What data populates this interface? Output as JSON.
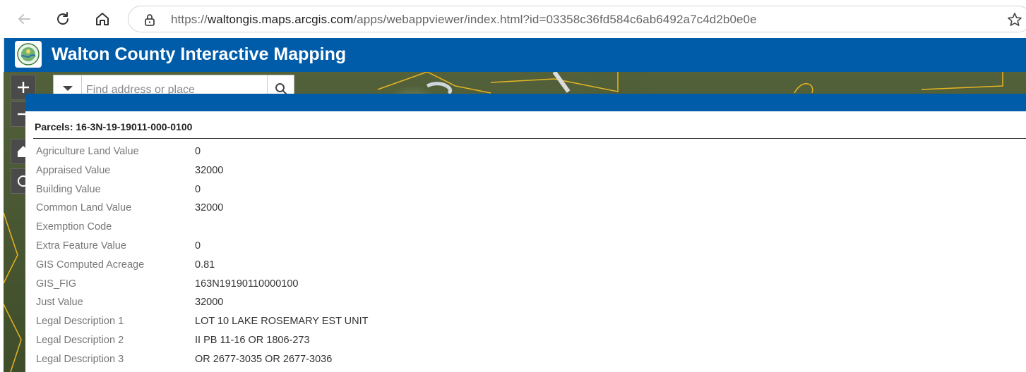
{
  "browser": {
    "url_prefix": "https://",
    "url_host": "waltongis.maps.arcgis.com",
    "url_path": "/apps/webappviewer/index.html?id=03358c36fd584c6ab6492a7c4d2b0e0e",
    "icons": [
      "back-arrow-icon",
      "reload-icon",
      "home-icon",
      "lock-icon",
      "favorite-star-icon"
    ]
  },
  "app": {
    "title": "Walton County Interactive Mapping",
    "header_color": "#005ca9",
    "logo_icon": "county-seal-logo"
  },
  "map": {
    "controls": [
      {
        "name": "zoom-in",
        "glyph": "+"
      },
      {
        "name": "zoom-out",
        "glyph": "−"
      },
      {
        "name": "default-extent",
        "glyph": "home"
      },
      {
        "name": "my-location",
        "glyph": "locate"
      }
    ],
    "search": {
      "placeholder": "Find address or place"
    }
  },
  "popup": {
    "title": "Parcels: 16-3N-19-19011-000-0100",
    "attributes": [
      {
        "name": "Agriculture Land Value",
        "value": "0"
      },
      {
        "name": "Appraised Value",
        "value": "32000"
      },
      {
        "name": "Building Value",
        "value": "0"
      },
      {
        "name": "Common Land Value",
        "value": "32000"
      },
      {
        "name": "Exemption Code",
        "value": ""
      },
      {
        "name": "Extra Feature Value",
        "value": "0"
      },
      {
        "name": "GIS Computed Acreage",
        "value": "0.81"
      },
      {
        "name": "GIS_FIG",
        "value": "163N19190110000100"
      },
      {
        "name": "Just Value",
        "value": "32000"
      },
      {
        "name": "Legal Description 1",
        "value": "LOT 10 LAKE ROSEMARY EST UNIT"
      },
      {
        "name": "Legal Description 2",
        "value": "II PB 11-16 OR 1806-273"
      },
      {
        "name": "Legal Description 3",
        "value": "OR 2677-3035 OR 2677-3036"
      }
    ]
  }
}
